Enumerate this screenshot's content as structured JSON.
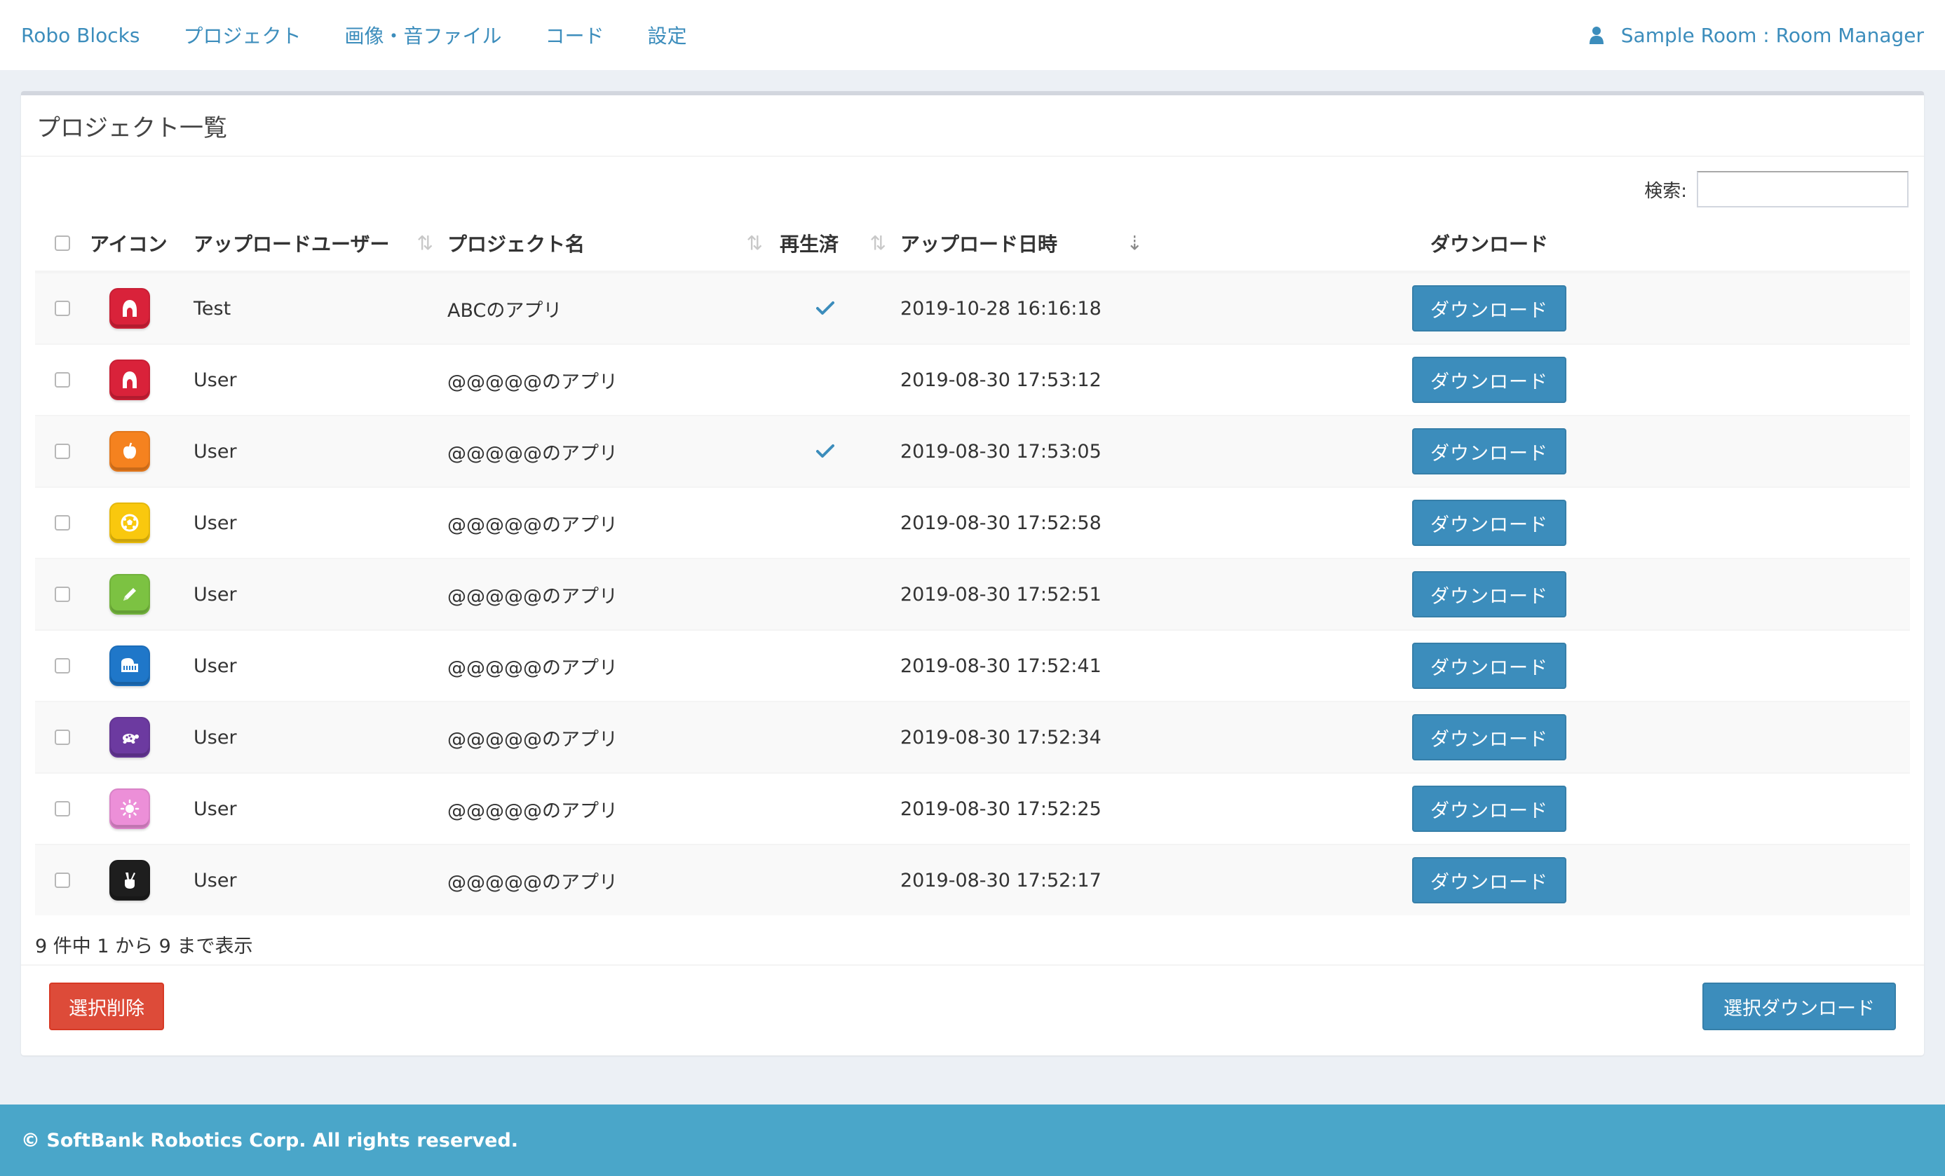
{
  "nav": {
    "brand": "Robo Blocks",
    "links": [
      "プロジェクト",
      "画像・音ファイル",
      "コード",
      "設定"
    ],
    "user_label": "Sample Room : Room Manager"
  },
  "box": {
    "title": "プロジェクト一覧",
    "search_label": "検索:",
    "search_value": ""
  },
  "table": {
    "headers": {
      "icon": "アイコン",
      "user": "アップロードユーザー",
      "project": "プロジェクト名",
      "played": "再生済",
      "date": "アップロード日時",
      "download": "ダウンロード"
    },
    "sort": {
      "active_column": "date",
      "direction": "desc"
    },
    "rows": [
      {
        "icon": "red-house-icon",
        "icon_color": "#d9223a",
        "user": "Test",
        "project": "ABCのアプリ",
        "played": true,
        "date": "2019-10-28 16:16:18",
        "download": "ダウンロード"
      },
      {
        "icon": "red-house-icon",
        "icon_color": "#d9223a",
        "user": "User",
        "project": "@@@@@のアプリ",
        "played": false,
        "date": "2019-08-30 17:53:12",
        "download": "ダウンロード"
      },
      {
        "icon": "orange-apple-icon",
        "icon_color": "#f5821f",
        "user": "User",
        "project": "@@@@@のアプリ",
        "played": true,
        "date": "2019-08-30 17:53:05",
        "download": "ダウンロード"
      },
      {
        "icon": "yellow-ball-icon",
        "icon_color": "#f9c80e",
        "user": "User",
        "project": "@@@@@のアプリ",
        "played": false,
        "date": "2019-08-30 17:52:58",
        "download": "ダウンロード"
      },
      {
        "icon": "green-pencil-icon",
        "icon_color": "#7cc242",
        "user": "User",
        "project": "@@@@@のアプリ",
        "played": false,
        "date": "2019-08-30 17:52:51",
        "download": "ダウンロード"
      },
      {
        "icon": "blue-piano-icon",
        "icon_color": "#1f77c9",
        "user": "User",
        "project": "@@@@@のアプリ",
        "played": false,
        "date": "2019-08-30 17:52:41",
        "download": "ダウンロード"
      },
      {
        "icon": "purple-turtle-icon",
        "icon_color": "#6c3aa0",
        "user": "User",
        "project": "@@@@@のアプリ",
        "played": false,
        "date": "2019-08-30 17:52:34",
        "download": "ダウンロード"
      },
      {
        "icon": "pink-sun-icon",
        "icon_color": "#ec8fd8",
        "user": "User",
        "project": "@@@@@のアプリ",
        "played": false,
        "date": "2019-08-30 17:52:25",
        "download": "ダウンロード"
      },
      {
        "icon": "black-peace-hand-icon",
        "icon_color": "#1e1e1e",
        "user": "User",
        "project": "@@@@@のアプリ",
        "played": false,
        "date": "2019-08-30 17:52:17",
        "download": "ダウンロード"
      }
    ]
  },
  "info_text": "9 件中 1 から 9 まで表示",
  "actions": {
    "delete_label": "選択削除",
    "bulk_download_label": "選択ダウンロード"
  },
  "footer": {
    "copyright": "© SoftBank Robotics Corp. All rights reserved."
  },
  "colors": {
    "accent": "#3c8dbc",
    "danger": "#dd4b39",
    "footer": "#4aa6c9",
    "background": "#ecf0f5"
  }
}
